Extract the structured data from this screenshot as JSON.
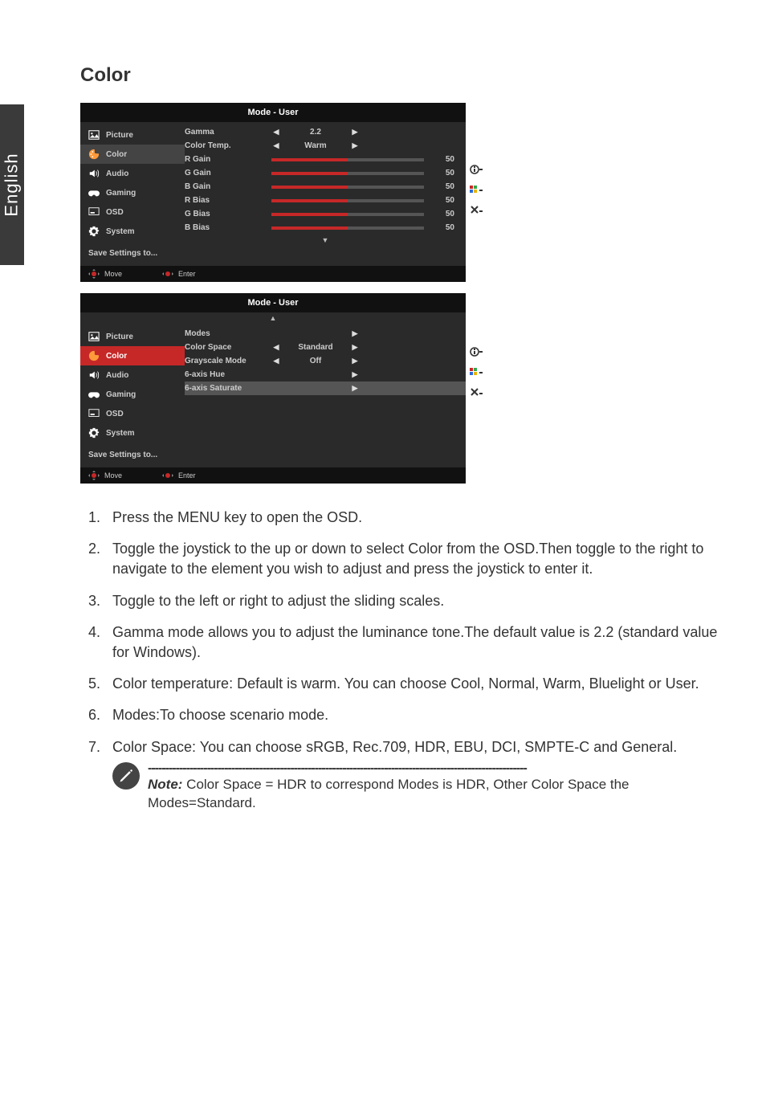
{
  "side_tab": "English",
  "section_title": "Color",
  "osd1": {
    "header": "Mode - User",
    "nav": [
      {
        "label": "Picture",
        "active": false
      },
      {
        "label": "Color",
        "active": true,
        "sel": true
      },
      {
        "label": "Audio",
        "active": false
      },
      {
        "label": "Gaming",
        "active": false
      },
      {
        "label": "OSD",
        "active": false
      },
      {
        "label": "System",
        "active": false
      }
    ],
    "save": "Save Settings to...",
    "rows": [
      {
        "label": "Gamma",
        "type": "lr",
        "value": "2.2"
      },
      {
        "label": "Color Temp.",
        "type": "lr",
        "value": "Warm"
      },
      {
        "label": "R Gain",
        "type": "slider",
        "value": "50"
      },
      {
        "label": "G Gain",
        "type": "slider",
        "value": "50"
      },
      {
        "label": "B Gain",
        "type": "slider",
        "value": "50"
      },
      {
        "label": "R Bias",
        "type": "slider",
        "value": "50"
      },
      {
        "label": "G Bias",
        "type": "slider",
        "value": "50"
      },
      {
        "label": "B Bias",
        "type": "slider",
        "value": "50"
      }
    ],
    "footer": {
      "move": "Move",
      "enter": "Enter"
    }
  },
  "osd2": {
    "header": "Mode - User",
    "nav": [
      {
        "label": "Picture",
        "active": false
      },
      {
        "label": "Color",
        "active": true
      },
      {
        "label": "Audio",
        "active": false
      },
      {
        "label": "Gaming",
        "active": false
      },
      {
        "label": "OSD",
        "active": false
      },
      {
        "label": "System",
        "active": false
      }
    ],
    "save": "Save Settings to...",
    "rows": [
      {
        "label": "Modes",
        "type": "r"
      },
      {
        "label": "Color Space",
        "type": "lr",
        "value": "Standard"
      },
      {
        "label": "Grayscale Mode",
        "type": "lr",
        "value": "Off"
      },
      {
        "label": "6-axis Hue",
        "type": "r"
      },
      {
        "label": "6-axis Saturate",
        "type": "r",
        "highlight": true
      }
    ],
    "footer": {
      "move": "Move",
      "enter": "Enter"
    }
  },
  "steps": [
    "Press the MENU key to open the OSD.",
    "Toggle the joystick to the up or down to select Color from the OSD.Then toggle to the right to navigate to the element you wish to adjust and press the joystick to enter it.",
    "Toggle to the left or right to adjust the sliding scales.",
    "Gamma mode allows you to adjust the luminance tone.The default value is 2.2 (standard value for Windows).",
    "Color temperature: Default is warm. You can choose Cool, Normal, Warm, Bluelight or User.",
    "Modes:To choose scenario mode.",
    "Color Space: You can choose sRGB, Rec.709, HDR, EBU, DCI, SMPTE-C and General."
  ],
  "note": {
    "label": "Note:",
    "text": " Color Space = HDR to correspond Modes is HDR, Other Color Space the Modes=Standard."
  }
}
